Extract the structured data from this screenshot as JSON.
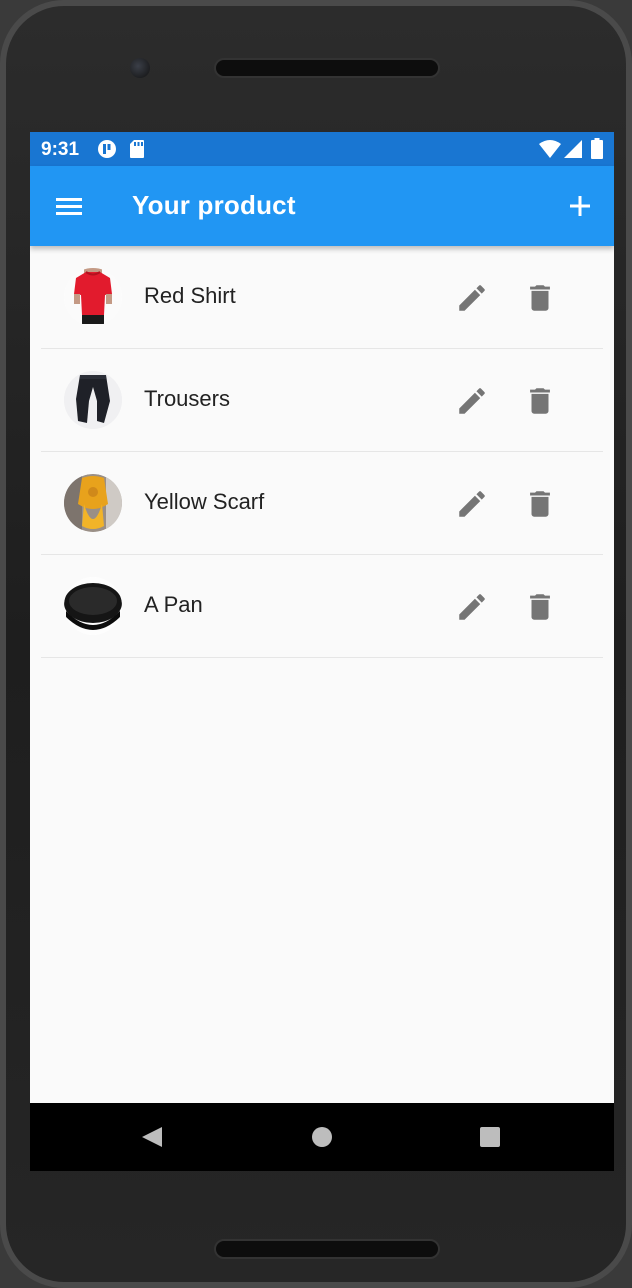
{
  "status_bar": {
    "time": "9:31",
    "left_icons": [
      "notification-app-icon",
      "sd-card-icon"
    ],
    "right_icons": [
      "wifi-icon",
      "signal-icon",
      "battery-icon"
    ],
    "color": "#1976d2"
  },
  "app_bar": {
    "title": "Your product",
    "menu_icon": "menu-icon",
    "action_icon": "add-icon",
    "color": "#2196f3"
  },
  "products": [
    {
      "name": "Red Shirt",
      "image": "red-shirt"
    },
    {
      "name": "Trousers",
      "image": "trousers"
    },
    {
      "name": "Yellow Scarf",
      "image": "yellow-scarf"
    },
    {
      "name": "A Pan",
      "image": "pan"
    }
  ],
  "row_actions": [
    "edit-icon",
    "delete-icon"
  ],
  "nav_bar": [
    "back-icon",
    "home-icon",
    "recents-icon"
  ]
}
